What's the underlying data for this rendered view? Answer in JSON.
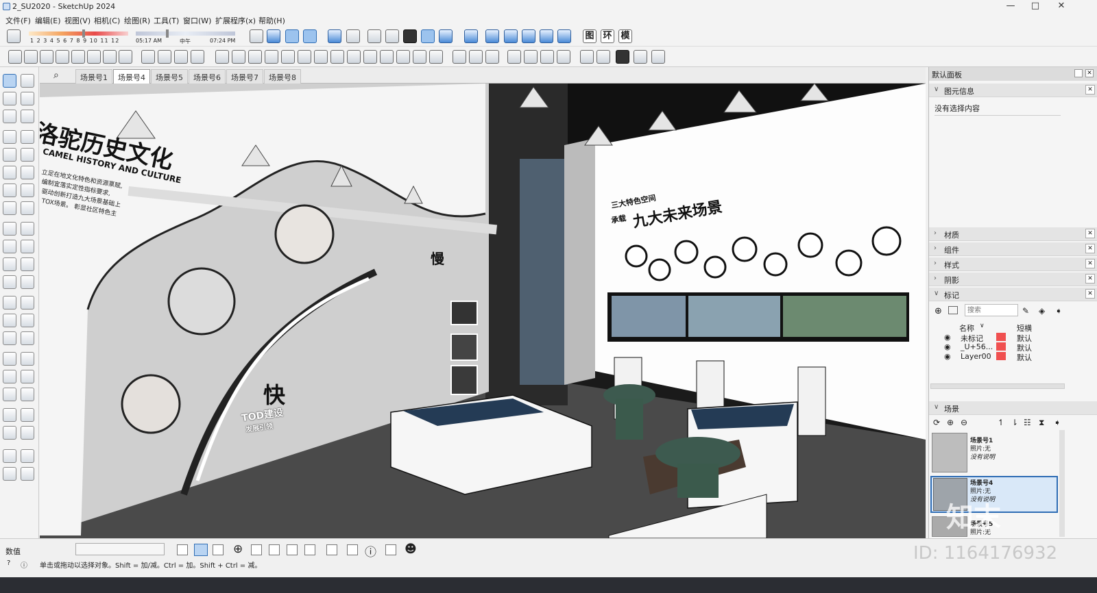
{
  "window": {
    "title": "2_SU2020 - SketchUp 2024",
    "min": "—",
    "max": "□",
    "close": "✕"
  },
  "menu": [
    "文件(F)",
    "编辑(E)",
    "视图(V)",
    "相机(C)",
    "绘图(R)",
    "工具(T)",
    "窗口(W)",
    "扩展程序(x)",
    "帮助(H)"
  ],
  "shadow_toolbar": {
    "months": "1 2 3 4 5 6 7 8 9 10 11 12",
    "time_start": "05:17 AM",
    "time_mid": "中午",
    "time_end": "07:24 PM"
  },
  "style_buttons": [
    "图",
    "环",
    "模"
  ],
  "scene_tabs": [
    "场景号1",
    "场景号4",
    "场景号5",
    "场景号6",
    "场景号7",
    "场景号8"
  ],
  "active_tab_index": 1,
  "viewport": {
    "left_wall_title": "洛驼历史文化",
    "left_wall_subtitle": "CAMEL HISTORY AND CULTURE",
    "left_wall_lines": [
      "立足在地文化特色和资源禀赋,",
      "编制宜落实定性指标要求,",
      "驱动创新打造九大场景基础上",
      "TOX场景。    彰显社区特色主"
    ],
    "char_fast": "快",
    "char_slow": "慢",
    "tod_label": "TOD建设",
    "tod_sub": "发展引领",
    "right_wall_small": "三大特色空间",
    "right_wall_small2": "承载",
    "right_wall_title": "九大未来场景"
  },
  "right_panel": {
    "title": "默认面板",
    "entity_info": {
      "title": "图元信息",
      "content": "没有选择内容"
    },
    "sections": [
      "材质",
      "组件",
      "样式",
      "阴影",
      "标记"
    ],
    "tags": {
      "search_placeholder": "搜索",
      "col_name": "名称",
      "col_dash": "短横",
      "rows": [
        {
          "name": "未标记",
          "dash": "默认",
          "color": "#f05050"
        },
        {
          "name": "_U+56...",
          "dash": "默认",
          "color": "#f05050"
        },
        {
          "name": "Layer00",
          "dash": "默认",
          "color": "#f05050"
        }
      ]
    },
    "scenes": {
      "title": "场景",
      "items": [
        {
          "name": "场景号1",
          "line1": "照片:无",
          "line2": "没有说明"
        },
        {
          "name": "场景号4",
          "line1": "照片:无",
          "line2": "没有说明"
        },
        {
          "name": "场景号5",
          "line1": "照片:无",
          "line2": ""
        }
      ]
    }
  },
  "status": {
    "measure_label": "数值",
    "hint": "单击或拖动以选择对象。Shift = 加/减。Ctrl = 加。Shift + Ctrl = 减。",
    "watermark": "知末",
    "id_text": "ID: 1164176932"
  },
  "colors": {
    "accent": "#2d6cb4",
    "tag_red": "#f05050"
  }
}
